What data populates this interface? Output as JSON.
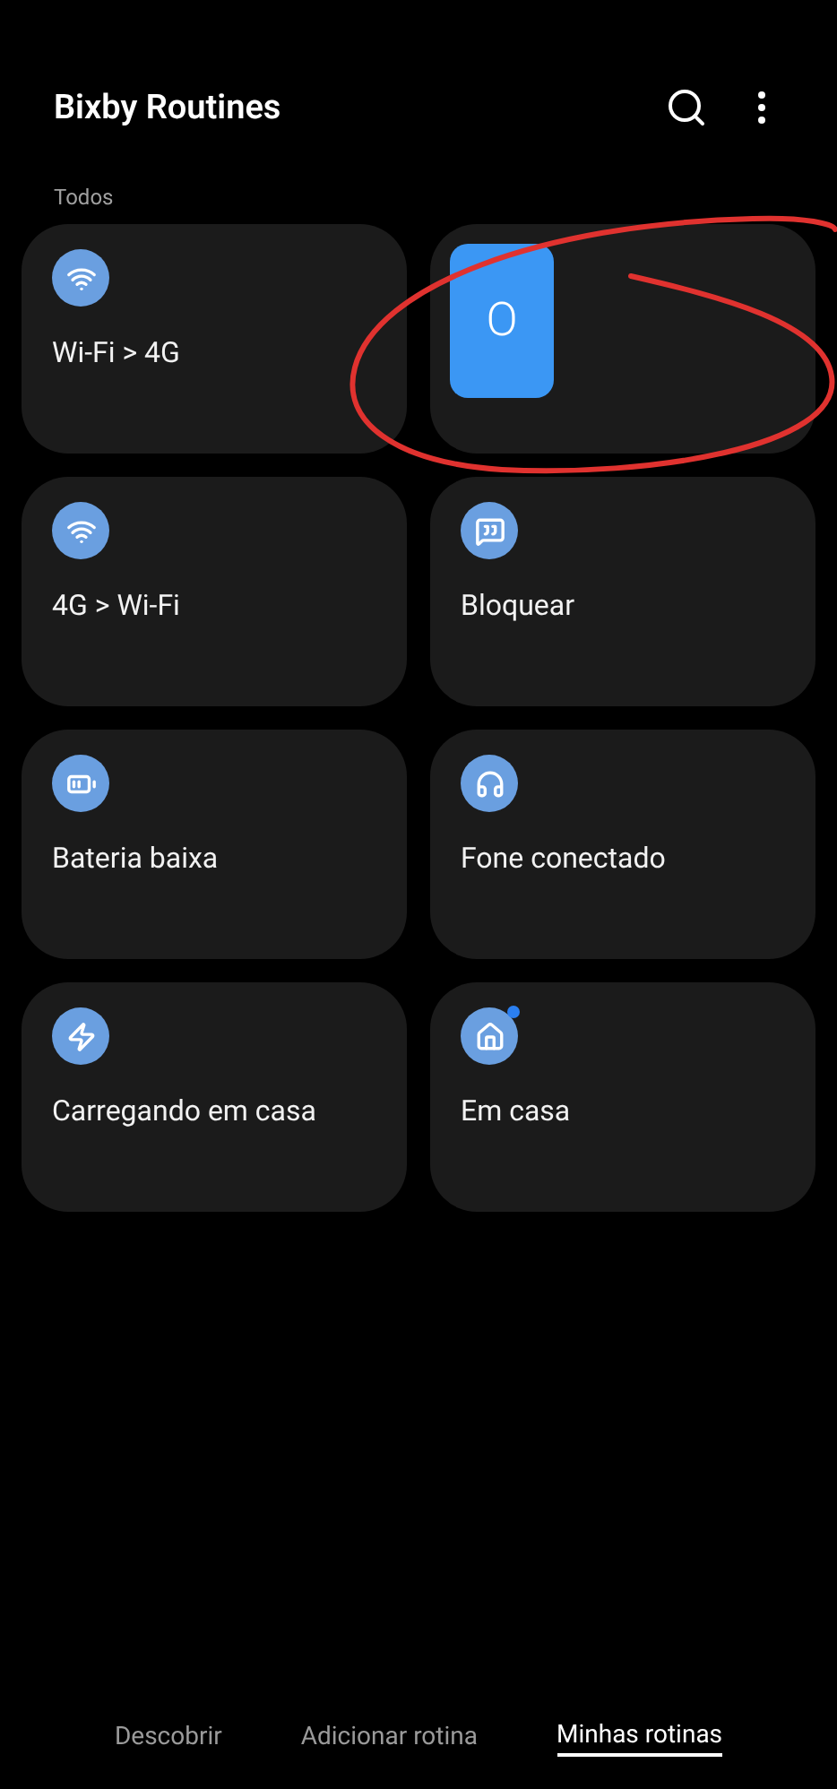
{
  "header": {
    "title": "Bixby Routines"
  },
  "section": {
    "label": "Todos"
  },
  "routines": [
    {
      "kind": "routine",
      "label": "Wi-Fi > 4G",
      "badge": false
    },
    {
      "kind": "placeholder",
      "label": "O"
    },
    {
      "kind": "routine",
      "label": "4G > Wi-Fi",
      "badge": false
    },
    {
      "kind": "routine",
      "label": "Bloquear",
      "badge": false
    },
    {
      "kind": "routine",
      "label": "Bateria baixa",
      "badge": false
    },
    {
      "kind": "routine",
      "label": "Fone conectado",
      "badge": false
    },
    {
      "kind": "routine",
      "label": "Carregando em casa",
      "badge": false
    },
    {
      "kind": "routine",
      "label": "Em casa",
      "badge": true
    }
  ],
  "tabs": [
    {
      "label": "Descobrir",
      "selected": false
    },
    {
      "label": "Adicionar rotina",
      "selected": false
    },
    {
      "label": "Minhas rotinas",
      "selected": true
    }
  ]
}
